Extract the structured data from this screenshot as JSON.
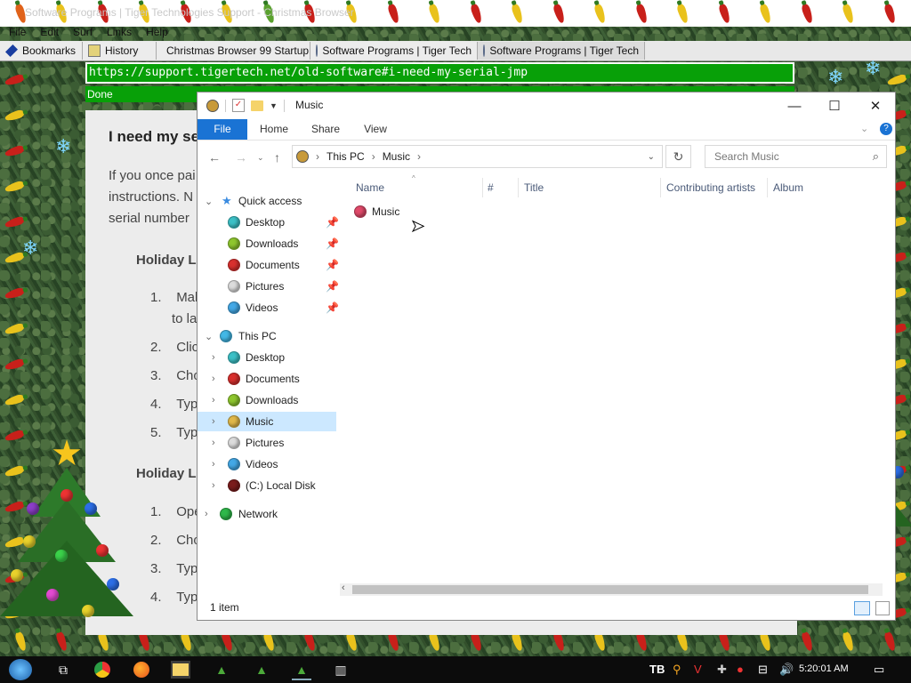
{
  "browser": {
    "title": "Software Programs | Tiger Technologies Support - Christmas Browser",
    "menu": [
      "File",
      "Edit",
      "Surf",
      "Links",
      "Help"
    ],
    "tabs": [
      {
        "label": "Bookmarks",
        "icon": "bookmark-icon"
      },
      {
        "label": "History",
        "icon": "history-icon"
      },
      {
        "label": "Christmas Browser 99 Startup",
        "icon": "globe-icon"
      },
      {
        "label": "Software Programs | Tiger Tech",
        "icon": "globe-icon"
      },
      {
        "label": "Software Programs | Tiger Tech",
        "icon": "globe-icon"
      }
    ],
    "url": "https://support.tigertech.net/old-software#i-need-my-serial-jmp",
    "status": "Done"
  },
  "page": {
    "heading": "I need my se",
    "para": [
      "If you once pai",
      "instructions. N",
      "serial number"
    ],
    "section1": "Holiday L",
    "list1": [
      {
        "num": "1.",
        "text": "Mak"
      },
      {
        "num": "",
        "text": "to la"
      },
      {
        "num": "2.",
        "text": "Clic"
      },
      {
        "num": "3.",
        "text": "Cho"
      },
      {
        "num": "4.",
        "text": "Type"
      },
      {
        "num": "5.",
        "text": "Type"
      }
    ],
    "section2": "Holiday L",
    "list2": [
      {
        "num": "1.",
        "text": "Ope"
      },
      {
        "num": "2.",
        "text": "Cho"
      },
      {
        "num": "3.",
        "text": "Type"
      },
      {
        "num": "4.",
        "text": "Type"
      }
    ]
  },
  "explorer": {
    "title": "Music",
    "ribbon_tabs": [
      "File",
      "Home",
      "Share",
      "View"
    ],
    "breadcrumb": [
      "This PC",
      "Music"
    ],
    "search_placeholder": "Search Music",
    "quick_access_label": "Quick access",
    "quick_access": [
      {
        "label": "Desktop",
        "color": "#3cc0c6"
      },
      {
        "label": "Downloads",
        "color": "#8ec62e"
      },
      {
        "label": "Documents",
        "color": "#d8302e"
      },
      {
        "label": "Pictures",
        "color": "#dcdcdc"
      },
      {
        "label": "Videos",
        "color": "#43a8e6"
      }
    ],
    "this_pc_label": "This PC",
    "this_pc": [
      {
        "label": "Desktop",
        "color": "#3cc0c6"
      },
      {
        "label": "Documents",
        "color": "#d8302e"
      },
      {
        "label": "Downloads",
        "color": "#8ec62e"
      },
      {
        "label": "Music",
        "color": "#e0b84a",
        "selected": true
      },
      {
        "label": "Pictures",
        "color": "#dcdcdc"
      },
      {
        "label": "Videos",
        "color": "#43a8e6"
      },
      {
        "label": "(C:) Local Disk",
        "color": "#7a1c1c"
      }
    ],
    "network_label": "Network",
    "columns": [
      "Name",
      "#",
      "Title",
      "Contributing artists",
      "Album"
    ],
    "files": [
      {
        "name": "Music",
        "color": "#e04a6a"
      }
    ],
    "status": "1 item"
  },
  "taskbar": {
    "clock": "5:20:01 AM"
  }
}
